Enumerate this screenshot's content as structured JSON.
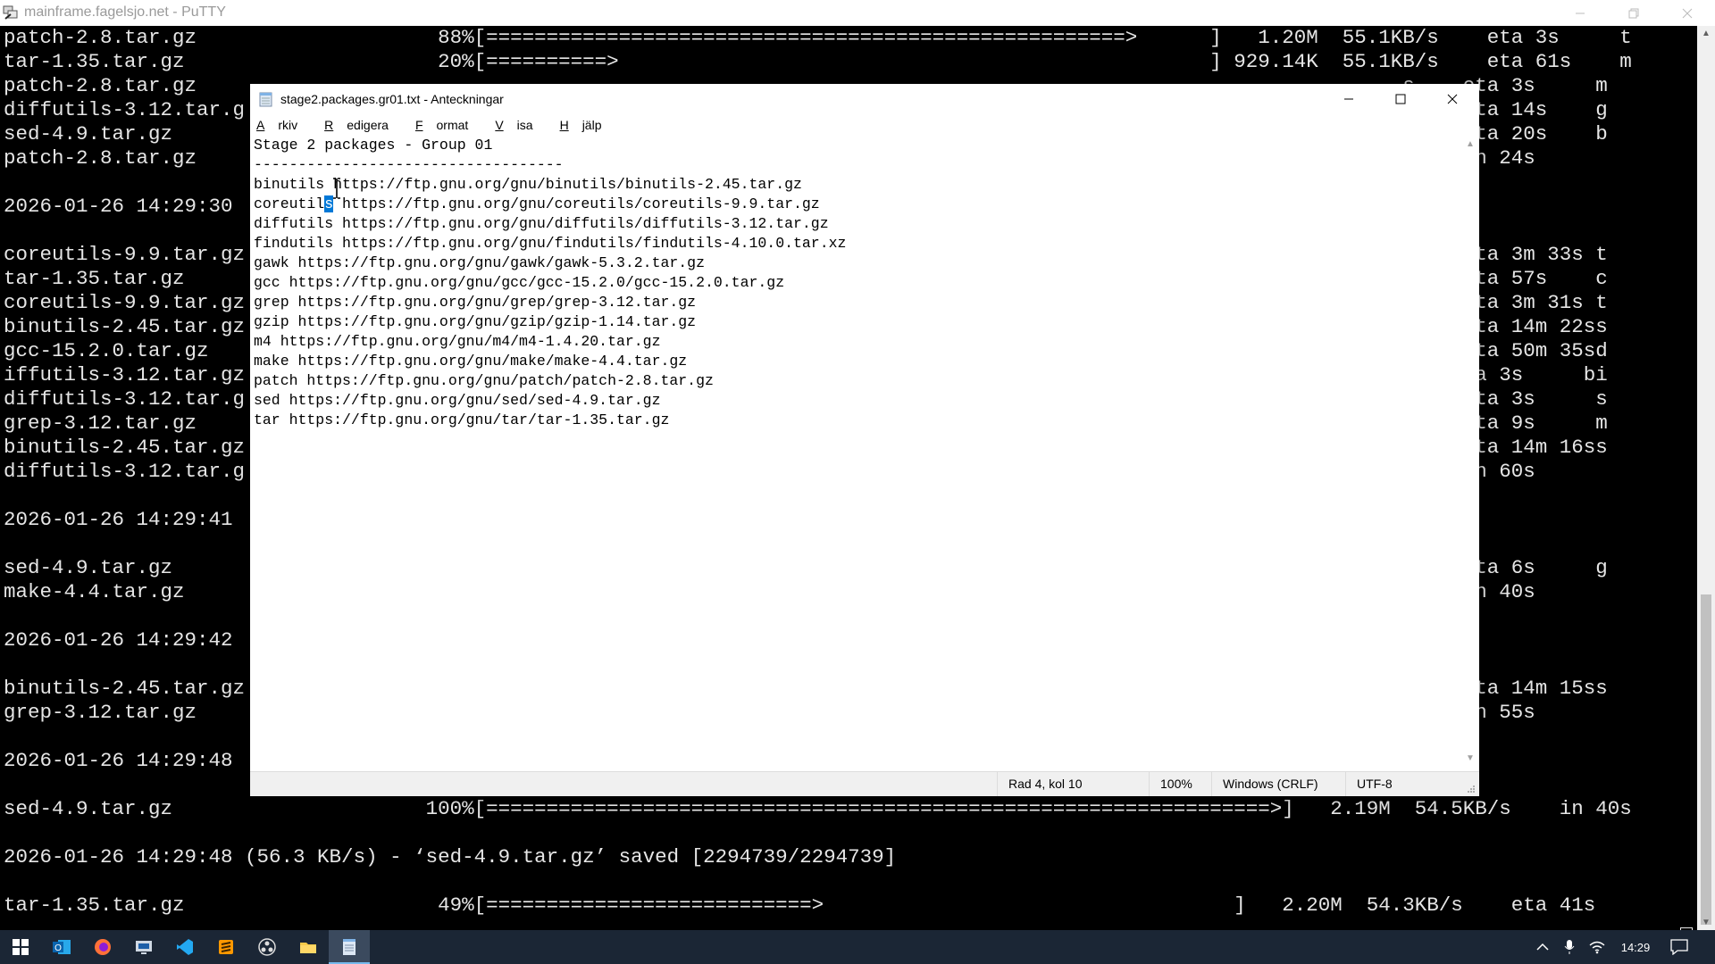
{
  "putty": {
    "window_title": "mainframe.fagelsjo.net - PuTTY",
    "terminal_lines": [
      "patch-2.8.tar.gz                    88%[=====================================================>      ]   1.20M  55.1KB/s    eta 3s     t",
      "tar-1.35.tar.gz                     20%[==========>                                                 ] 929.14K  55.1KB/s    eta 61s    m",
      "patch-2.8.tar.gz                                                                                                    s    eta 3s     m",
      "diffutils-3.12.tar.g                                                                                                s    eta 14s    g",
      "sed-4.9.tar.gz                                                                                                      s    eta 20s    b",
      "patch-2.8.tar.gz                                                                                                    s    in 24s",
      "",
      "2026-01-26 14:29:30",
      "",
      "coreutils-9.9.tar.gz                                                                                                s    eta 3m 33s t",
      "tar-1.35.tar.gz                                                                                                     s    eta 57s    c",
      "coreutils-9.9.tar.gz                                                                                                s    eta 3m 31s t",
      "binutils-2.45.tar.gz                                                                                                s    eta 14m 22ss",
      "gcc-15.2.0.tar.gz                                                                                                   s    eta 50m 35sd",
      "iffutils-3.12.tar.gz                                                                                                    eta 3s     bi",
      "diffutils-3.12.tar.g                                                                                                s    eta 3s     s",
      "grep-3.12.tar.gz                                                                                                    s    eta 9s     m",
      "binutils-2.45.tar.gz                                                                                                s    eta 14m 16ss",
      "diffutils-3.12.tar.g                                                                                                s    in 60s",
      "",
      "2026-01-26 14:29:41",
      "",
      "sed-4.9.tar.gz                                                                                                      s    eta 6s     g",
      "make-4.4.tar.gz                                                                                                     s    in 40s",
      "",
      "2026-01-26 14:29:42",
      "",
      "binutils-2.45.tar.gz                                                                                                s    eta 14m 15ss",
      "grep-3.12.tar.gz                                                                                                    s    in 55s",
      "",
      "2026-01-26 14:29:48",
      "",
      "sed-4.9.tar.gz                     100%[=================================================================>]   2.19M  54.5KB/s    in 40s",
      "",
      "2026-01-26 14:29:48 (56.3 KB/s) - ‘sed-4.9.tar.gz’ saved [2294739/2294739]",
      "",
      "tar-1.35.tar.gz                     49%[===========================>                                  ]   2.20M  54.3KB/s    eta 41s"
    ]
  },
  "notepad": {
    "window_title": "stage2.packages.gr01.txt - Anteckningar",
    "menu": [
      {
        "accel": "A",
        "rest": "rkiv"
      },
      {
        "accel": "R",
        "rest": "edigera"
      },
      {
        "accel": "F",
        "rest": "ormat"
      },
      {
        "accel": "V",
        "rest": "isa"
      },
      {
        "accel": "H",
        "rest": "jälp"
      }
    ],
    "content_lines": [
      "Stage 2 packages - Group 01",
      "-----------------------------------",
      "binutils https://ftp.gnu.org/gnu/binutils/binutils-2.45.tar.gz",
      "coreutils https://ftp.gnu.org/gnu/coreutils/coreutils-9.9.tar.gz",
      "diffutils https://ftp.gnu.org/gnu/diffutils/diffutils-3.12.tar.gz",
      "findutils https://ftp.gnu.org/gnu/findutils/findutils-4.10.0.tar.xz",
      "gawk https://ftp.gnu.org/gnu/gawk/gawk-5.3.2.tar.gz",
      "gcc https://ftp.gnu.org/gnu/gcc/gcc-15.2.0/gcc-15.2.0.tar.gz",
      "grep https://ftp.gnu.org/gnu/grep/grep-3.12.tar.gz",
      "gzip https://ftp.gnu.org/gnu/gzip/gzip-1.14.tar.gz",
      "m4 https://ftp.gnu.org/gnu/m4/m4-1.4.20.tar.gz",
      "make https://ftp.gnu.org/gnu/make/make-4.4.tar.gz",
      "patch https://ftp.gnu.org/gnu/patch/patch-2.8.tar.gz",
      "sed https://ftp.gnu.org/gnu/sed/sed-4.9.tar.gz",
      "tar https://ftp.gnu.org/gnu/tar/tar-1.35.tar.gz"
    ],
    "selection": {
      "line": 3,
      "before": "coreutil",
      "selected": "s",
      "after": " https://ftp.gnu.org/gnu/coreutils/coreutils-9.9.tar.gz"
    },
    "status": {
      "position": "Rad 4, kol 10",
      "zoom": "100%",
      "line_ending": "Windows (CRLF)",
      "encoding": "UTF-8"
    }
  },
  "taskbar": {
    "apps": [
      "start-icon",
      "outlook-icon",
      "firefox-icon",
      "rdp-icon",
      "vscode-icon",
      "sublime-icon",
      "obs-icon",
      "file-explorer-icon",
      "notepad-icon"
    ],
    "clock": "14:29"
  },
  "colors": {
    "terminal_bg": "#000000",
    "terminal_fg": "#e6e6e6",
    "selection": "#0078d7",
    "taskbar": "#1b2635"
  }
}
